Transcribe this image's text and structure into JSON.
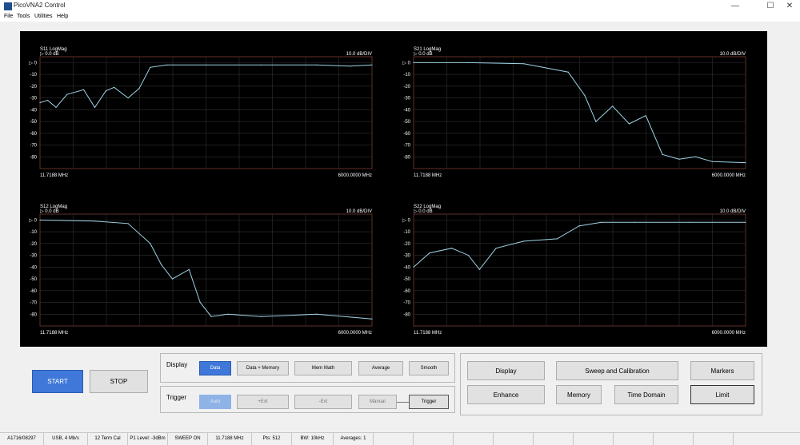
{
  "window": {
    "title": "PicoVNA2 Control",
    "min_glyph": "—",
    "max_glyph": "☐",
    "close_glyph": "✕"
  },
  "menu": [
    "File",
    "Tools",
    "Utilities",
    "Help"
  ],
  "colors": {
    "trace": "#9fd3e6",
    "grid": "#303030",
    "frame": "#7a3b30",
    "start_button": "#3f78d8"
  },
  "plots": [
    {
      "id": "s11",
      "title": "S11 LogMag",
      "ref": "▷  0.0 dB",
      "scale": "10.0 dB/DIV",
      "ref_marker": "▷",
      "yticks": [
        "0",
        "-10",
        "-20",
        "-30",
        "-40",
        "-50",
        "-60",
        "-70",
        "-80"
      ],
      "xstart": "11.7188 MHz",
      "xstop": "6000.0000 MHz"
    },
    {
      "id": "s21",
      "title": "S21 LogMag",
      "ref": "▷  0.0 dB",
      "scale": "10.0 dB/DIV",
      "ref_marker": "▷",
      "yticks": [
        "0",
        "-10",
        "-20",
        "-30",
        "-40",
        "-50",
        "-60",
        "-70",
        "-80"
      ],
      "xstart": "11.7188 MHz",
      "xstop": "6000.0000 MHz"
    },
    {
      "id": "s12",
      "title": "S12 LogMag",
      "ref": "▷  0.0 dB",
      "scale": "10.0 dB/DIV",
      "ref_marker": "▷",
      "yticks": [
        "0",
        "-10",
        "-20",
        "-30",
        "-40",
        "-50",
        "-60",
        "-70",
        "-80"
      ],
      "xstart": "11.7188 MHz",
      "xstop": "6000.0000 MHz"
    },
    {
      "id": "s22",
      "title": "S22 LogMag",
      "ref": "▷  0.0 dB",
      "scale": "10.0 dB/DIV",
      "ref_marker": "▷",
      "yticks": [
        "0",
        "-10",
        "-20",
        "-30",
        "-40",
        "-50",
        "-60",
        "-70",
        "-80"
      ],
      "xstart": "11.7188 MHz",
      "xstop": "6000.0000 MHz"
    }
  ],
  "chart_data": [
    {
      "type": "line",
      "title": "S11 LogMag",
      "ylim": [
        -90,
        5
      ],
      "xlim": [
        11.7188,
        6000
      ],
      "x_unit": "MHz",
      "y_unit": "dB",
      "series": [
        {
          "values_x": [
            11.7,
            150,
            300,
            500,
            800,
            1000,
            1200,
            1350,
            1600,
            1800,
            2000,
            2300,
            3000,
            4000,
            5000,
            5600,
            6000
          ],
          "values_y": [
            -34,
            -32,
            -38,
            -27,
            -23,
            -38,
            -24,
            -21,
            -30,
            -22,
            -4,
            -2,
            -2,
            -2,
            -2,
            -3,
            -2
          ]
        }
      ]
    },
    {
      "type": "line",
      "title": "S21 LogMag",
      "ylim": [
        -90,
        5
      ],
      "xlim": [
        11.7188,
        6000
      ],
      "x_unit": "MHz",
      "y_unit": "dB",
      "series": [
        {
          "values_x": [
            11.7,
            1000,
            2000,
            2800,
            3100,
            3300,
            3600,
            3900,
            4200,
            4500,
            4800,
            5100,
            5400,
            6000
          ],
          "values_y": [
            0,
            0,
            -1,
            -8,
            -28,
            -50,
            -37,
            -52,
            -45,
            -78,
            -82,
            -80,
            -84,
            -85
          ]
        }
      ]
    },
    {
      "type": "line",
      "title": "S12 LogMag",
      "ylim": [
        -90,
        5
      ],
      "xlim": [
        11.7188,
        6000
      ],
      "x_unit": "MHz",
      "y_unit": "dB",
      "series": [
        {
          "values_x": [
            11.7,
            1000,
            1600,
            2000,
            2200,
            2400,
            2700,
            2900,
            3100,
            3400,
            4000,
            5000,
            6000
          ],
          "values_y": [
            0,
            -1,
            -3,
            -20,
            -38,
            -50,
            -42,
            -70,
            -82,
            -80,
            -82,
            -80,
            -84
          ]
        }
      ]
    },
    {
      "type": "line",
      "title": "S22 LogMag",
      "ylim": [
        -90,
        5
      ],
      "xlim": [
        11.7188,
        6000
      ],
      "x_unit": "MHz",
      "y_unit": "dB",
      "series": [
        {
          "values_x": [
            11.7,
            300,
            700,
            1000,
            1200,
            1500,
            2000,
            2600,
            3000,
            3400,
            4000,
            5000,
            6000
          ],
          "values_y": [
            -40,
            -28,
            -24,
            -30,
            -42,
            -24,
            -18,
            -16,
            -5,
            -2,
            -2,
            -2,
            -2
          ]
        }
      ]
    }
  ],
  "display_group": {
    "label": "Display",
    "buttons": [
      "Data",
      "Data + Memory",
      "Mem Math",
      "Average",
      "Smooth"
    ]
  },
  "trigger_group": {
    "label": "Trigger",
    "buttons": [
      "Auto",
      "+Ext",
      "-Ext",
      "Manual",
      "Trigger"
    ]
  },
  "main_buttons": {
    "start": "START",
    "stop": "STOP"
  },
  "right_buttons": [
    "Display",
    "Sweep and Calibration",
    "Markers",
    "Enhance",
    "Memory",
    "Time Domain",
    "Limit"
  ],
  "status": [
    "A1716/08297",
    "USB, 4 Mb/s",
    "12 Term Cal",
    "P1 Level: -3dBm",
    "SWEEP ON",
    "11.7188 MHz",
    "Pts: 512",
    "BW: 10kHz",
    "Averages: 1"
  ]
}
